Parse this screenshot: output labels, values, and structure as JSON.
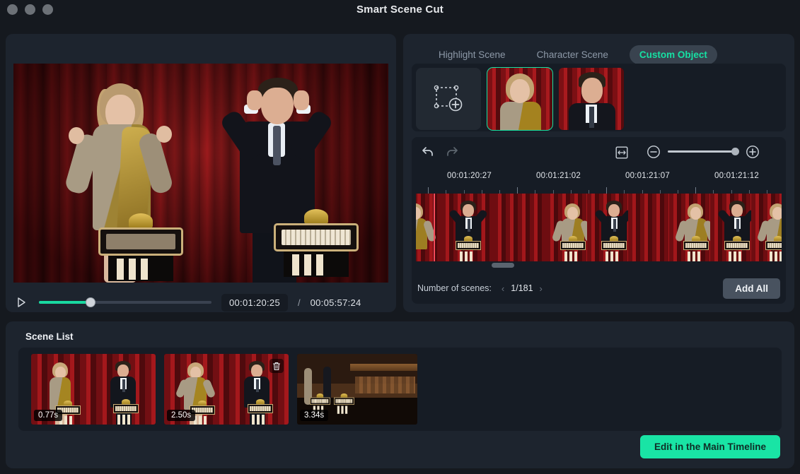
{
  "window": {
    "title": "Smart Scene Cut",
    "controls": [
      "close-button",
      "minimize-button",
      "maximize-button"
    ]
  },
  "preview": {
    "play_icon": "play-icon",
    "progress_percent": 30,
    "current_time": "00:01:20:25",
    "separator": "/",
    "total_time": "00:05:57:24"
  },
  "tabs": [
    {
      "label": "Highlight Scene",
      "active": false
    },
    {
      "label": "Character Scene",
      "active": false
    },
    {
      "label": "Custom Object",
      "active": true
    }
  ],
  "objects": {
    "add_icon": "add-selection-icon",
    "items": [
      {
        "name": "object-thumb-woman",
        "selected": true
      },
      {
        "name": "object-thumb-man",
        "selected": false
      }
    ]
  },
  "timeline": {
    "toolbar": {
      "undo_icon": "undo-icon",
      "redo_icon": "redo-icon",
      "fit_icon": "fit-to-width-icon",
      "zoom_out_icon": "zoom-out-icon",
      "zoom_in_icon": "zoom-in-icon",
      "zoom_percent": 93
    },
    "ruler_times": [
      "00:01:20:27",
      "00:01:21:02",
      "00:01:21:07",
      "00:01:21:12"
    ],
    "playhead_position_percent": 4
  },
  "scene_counter": {
    "label": "Number of scenes:",
    "prev_icon": "chevron-left-icon",
    "value": "1/181",
    "next_icon": "chevron-right-icon"
  },
  "add_all_label": "Add All",
  "scene_list": {
    "title": "Scene List",
    "scenes": [
      {
        "duration": "0.77s",
        "has_delete": false
      },
      {
        "duration": "2.50s",
        "has_delete": true
      },
      {
        "duration": "3.34s",
        "has_delete": false
      }
    ],
    "delete_icon": "trash-icon"
  },
  "edit_button_label": "Edit in the Main Timeline",
  "colors": {
    "accent": "#19e4a5",
    "playhead": "#f74a5a",
    "panel_bg": "#1d242e",
    "window_bg": "#15191f",
    "inner_bg": "#161c25"
  }
}
